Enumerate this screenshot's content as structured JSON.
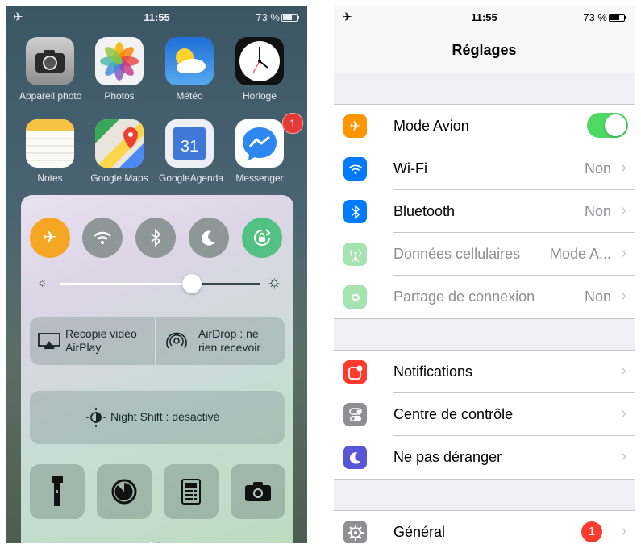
{
  "left": {
    "status": {
      "time": "11:55",
      "battery": "73 %"
    },
    "apps": [
      {
        "label": "Appareil photo",
        "icon": "camera-app-icon"
      },
      {
        "label": "Photos",
        "icon": "photos-app-icon"
      },
      {
        "label": "Météo",
        "icon": "weather-app-icon"
      },
      {
        "label": "Horloge",
        "icon": "clock-app-icon"
      },
      {
        "label": "Notes",
        "icon": "notes-app-icon"
      },
      {
        "label": "Google Maps",
        "icon": "google-maps-app-icon"
      },
      {
        "label": "GoogleAgenda",
        "icon": "google-calendar-app-icon",
        "day": "31"
      },
      {
        "label": "Messenger",
        "icon": "messenger-app-icon",
        "badge": "1"
      }
    ],
    "control_center": {
      "toggles": [
        {
          "name": "airplane",
          "on": true
        },
        {
          "name": "wifi",
          "on": false
        },
        {
          "name": "bluetooth",
          "on": false
        },
        {
          "name": "do-not-disturb",
          "on": false
        },
        {
          "name": "rotation-lock",
          "on": true
        }
      ],
      "brightness_level": 0.66,
      "airplay_label_1": "Recopie vidéo",
      "airplay_label_2": "AirPlay",
      "airdrop_label_1": "AirDrop : ne",
      "airdrop_label_2": "rien recevoir",
      "night_shift_label": "Night Shift : désactivé",
      "tools": [
        "flashlight",
        "timer",
        "calculator",
        "camera"
      ]
    }
  },
  "right": {
    "status": {
      "time": "11:55",
      "battery": "73 %"
    },
    "title": "Réglages",
    "group1": [
      {
        "label": "Mode Avion",
        "value": "",
        "icon": "airplane-icon",
        "color": "#ff9500"
      },
      {
        "label": "Wi-Fi",
        "value": "Non",
        "icon": "wifi-icon",
        "color": "#007aff"
      },
      {
        "label": "Bluetooth",
        "value": "Non",
        "icon": "bluetooth-icon",
        "color": "#007aff"
      },
      {
        "label": "Données cellulaires",
        "value": "Mode A...",
        "icon": "cellular-icon",
        "color": "#a6e3b0"
      },
      {
        "label": "Partage de connexion",
        "value": "Non",
        "icon": "hotspot-icon",
        "color": "#a6e3b0"
      }
    ],
    "group2": [
      {
        "label": "Notifications",
        "icon": "notifications-icon",
        "color": "#ff3b30"
      },
      {
        "label": "Centre de contrôle",
        "icon": "control-center-icon",
        "color": "#8e8e93"
      },
      {
        "label": "Ne pas déranger",
        "icon": "do-not-disturb-icon",
        "color": "#5856d6"
      }
    ],
    "group3": [
      {
        "label": "Général",
        "badge": "1",
        "icon": "gear-icon",
        "color": "#8e8e93"
      }
    ]
  }
}
